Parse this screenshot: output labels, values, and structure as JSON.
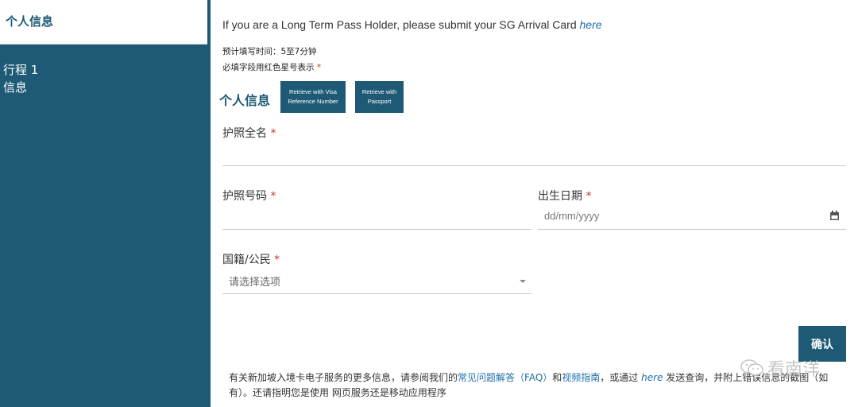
{
  "sidebar": {
    "active_item": "个人信息",
    "steps": [
      "行程 1",
      "信息"
    ]
  },
  "notice": {
    "text": "If you are a Long Term Pass Holder, please submit your SG Arrival Card ",
    "link": "here"
  },
  "meta": {
    "estimated_time": "预计填写时间：5至7分钟",
    "required_note": "必填字段用红色星号表示",
    "required_mark": "*"
  },
  "section": {
    "title": "个人信息",
    "retrieve_visa": "Retrieve with Visa Reference Number",
    "retrieve_passport": "Retrieve with Passport"
  },
  "form": {
    "passport_name_label": "护照全名",
    "passport_number_label": "护照号码",
    "dob_label": "出生日期",
    "dob_placeholder": "dd/mm/yyyy",
    "nationality_label": "国籍/公民",
    "nationality_value": "请选择选项"
  },
  "confirm_label": "确认",
  "footer": {
    "part1": "有关新加坡入境卡电子服务的更多信息，请参阅我们的",
    "faq_link": "常见问题解答（FAQ）",
    "and": "和",
    "video_link": "视频指南",
    "part2": "，或通过",
    "here_link": "here",
    "part3": "发送查询，并附上错误信息的截图（如有）。还请指明您是使用 网页服务还是移动应用程序"
  },
  "watermark": "看南洋",
  "colors": {
    "primary": "#1e5a75",
    "link": "#1e6fa8",
    "required": "#c0392b"
  }
}
